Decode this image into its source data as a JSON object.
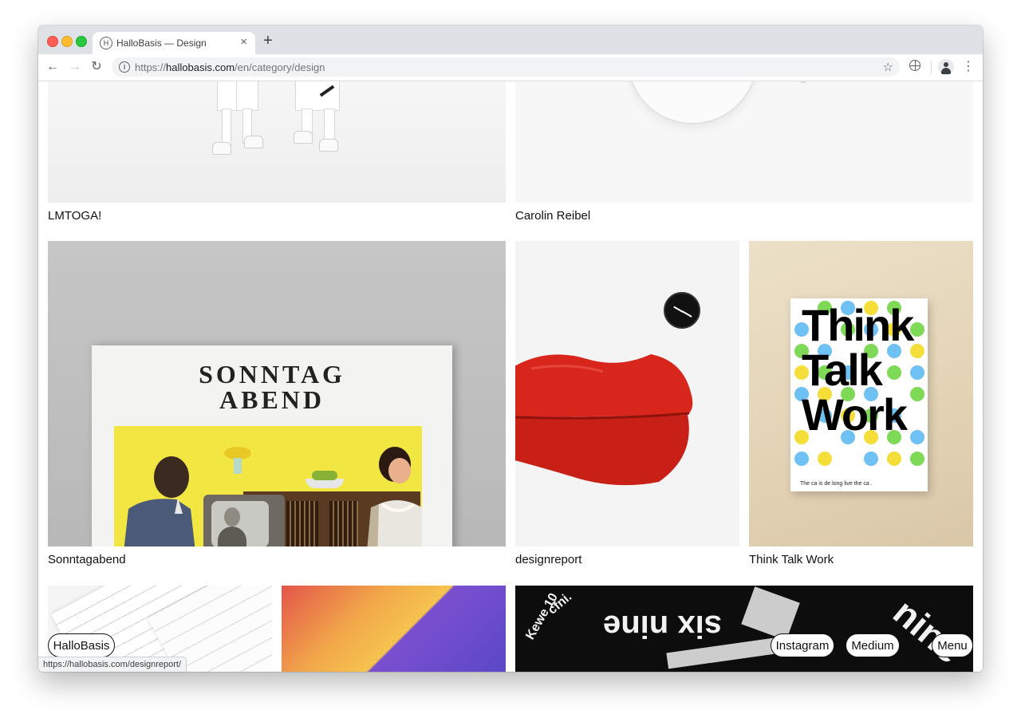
{
  "browser": {
    "tab_title": "HalloBasis — Design",
    "favicon_letter": "H",
    "tab_close": "×",
    "new_tab": "+",
    "url_scheme": "https://",
    "url_domain": "hallobasis.com",
    "url_path": "/en/category/design",
    "back": "←",
    "forward": "→",
    "reload": "↻",
    "info": "i",
    "bookmark": "☆",
    "menu": "⋮"
  },
  "projects": [
    {
      "caption": "LMTOGA!"
    },
    {
      "caption": "Carolin Reibel"
    },
    {
      "caption": "Sonntagabend",
      "cover_lines": [
        "SONNTAG",
        "ABEND"
      ]
    },
    {
      "caption": "designreport"
    },
    {
      "caption": "Think Talk Work",
      "cover_lines": [
        "Think",
        "Talk",
        "Work"
      ],
      "cover_footer": "The ca      is de      long live the ca      ."
    }
  ],
  "sixnine_texts": [
    "six nine",
    "Kewe 10",
    "cfni.",
    "nine"
  ],
  "floating_nav": {
    "brand": "HalloBasis",
    "links": [
      "Instagram",
      "Medium",
      "Menu"
    ]
  },
  "status_url": "https://hallobasis.com/designreport/",
  "colors": {
    "tab_strip": "#dee1e6",
    "magazine_yellow": "#f2e642",
    "lips_red": "#d9261c",
    "dot_yellow": "#f5dd3a",
    "dot_green": "#7ed957",
    "dot_blue": "#6ec1f2"
  }
}
